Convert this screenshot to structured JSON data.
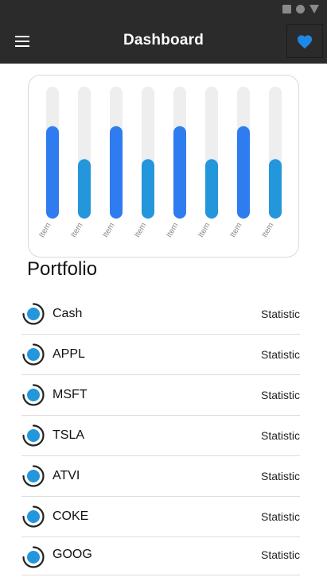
{
  "status_bar": {
    "icons": [
      "square-icon",
      "circle-icon",
      "triangle-icon"
    ]
  },
  "app_bar": {
    "title": "Dashboard",
    "menu_icon": "hamburger-menu-icon",
    "favorite_icon": "heart-icon",
    "background": "#2b2b2b",
    "accent": "#1e88e5"
  },
  "chart_data": {
    "type": "bar",
    "categories": [
      "Item",
      "Item",
      "Item",
      "Item",
      "Item",
      "Item",
      "Item",
      "Item"
    ],
    "values": [
      70,
      45,
      70,
      45,
      70,
      45,
      70,
      45
    ],
    "ylim": [
      0,
      100
    ],
    "colors": [
      "#2f7cf0",
      "#2496db",
      "#2f7cf0",
      "#2496db",
      "#2f7cf0",
      "#2496db",
      "#2f7cf0",
      "#2496db"
    ],
    "track_color": "#eeeeee",
    "grid": false,
    "title": "",
    "xlabel": "",
    "ylabel": ""
  },
  "portfolio": {
    "title": "Portfolio",
    "items": [
      {
        "name": "Cash",
        "stat": "Statistic"
      },
      {
        "name": "APPL",
        "stat": "Statistic"
      },
      {
        "name": "MSFT",
        "stat": "Statistic"
      },
      {
        "name": "TSLA",
        "stat": "Statistic"
      },
      {
        "name": "ATVI",
        "stat": "Statistic"
      },
      {
        "name": "COKE",
        "stat": "Statistic"
      },
      {
        "name": "GOOG",
        "stat": "Statistic"
      }
    ]
  }
}
